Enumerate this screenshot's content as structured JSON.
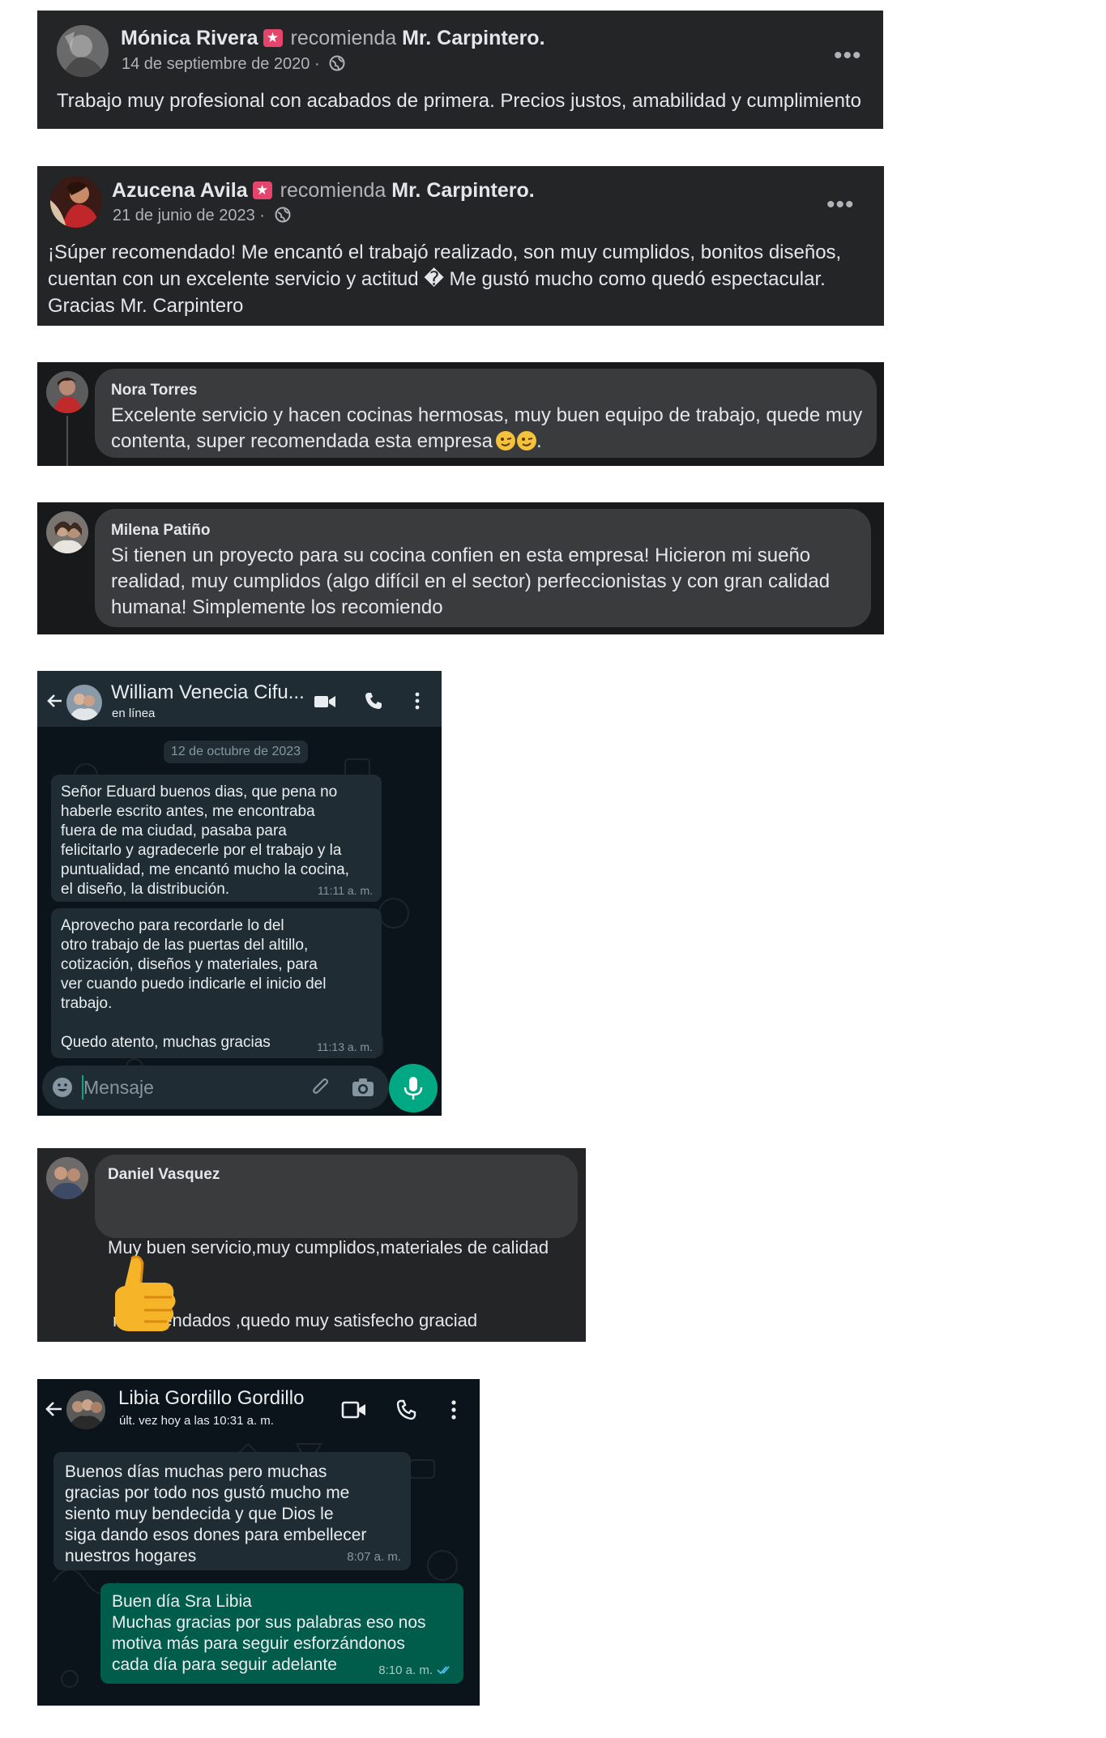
{
  "post1": {
    "author": "Mónica Rivera",
    "verb": "recomienda",
    "page": "Mr. Carpintero.",
    "date": "14 de septiembre de 2020 ·",
    "more": "•••",
    "text": "Trabajo muy profesional con acabados de primera. Precios justos, amabilidad y cumplimiento"
  },
  "post2": {
    "author": "Azucena Avila",
    "verb": "recomienda",
    "page": "Mr. Carpintero.",
    "date": "21 de junio de 2023 ·",
    "more": "•••",
    "text_lines": [
      "¡Súper recomendado! Me encantó el trabajó realizado, son muy cumplidos, bonitos diseños,",
      "cuentan con un excelente servicio y actitud � Me gustó mucho como quedó espectacular.",
      "Gracias Mr. Carpintero"
    ]
  },
  "comment1": {
    "author": "Nora Torres",
    "text_lines": [
      "Excelente servicio y hacen cocinas hermosas, muy buen equipo de trabajo, quede muy",
      "contenta, super recomendada esta empresa"
    ],
    "text_end": "."
  },
  "comment2": {
    "author": "Milena Patiño",
    "text_lines": [
      "Si tienen un proyecto para su cocina confien en esta empresa! Hicieron mi sueño",
      "realidad, muy cumplidos (algo difícil en el sector) perfeccionistas y con gran calidad",
      "humana! Simplemente los recomiendo"
    ]
  },
  "wa1": {
    "contact": "William Venecia Cifu...",
    "status": "en línea",
    "date_chip": "12 de octubre de 2023",
    "msg1_lines": [
      "Señor Eduard buenos dias, que pena no",
      "haberle escrito antes, me encontraba",
      "fuera de ma ciudad, pasaba para",
      "felicitarlo y agradecerle por el trabajo y la",
      "puntualidad, me encantó mucho la cocina,",
      "el diseño, la distribución."
    ],
    "msg1_time": "11:11 a. m.",
    "msg2_lines": [
      "Aprovecho para recordarle lo del",
      "otro trabajo de las puertas del altillo,",
      "cotización, diseños y materiales, para",
      "ver cuando puedo indicarle el inicio del",
      "trabajo."
    ],
    "msg2_last": "Quedo atento, muchas gracias",
    "msg2_time": "11:13 a. m.",
    "input_placeholder": "Mensaje"
  },
  "comment3": {
    "author": "Daniel Vasquez",
    "text_lines": [
      "Muy buen servicio,muy cumplidos,materiales de calidad",
      " recomendados ,quedo muy satisfecho graciad"
    ]
  },
  "wa2": {
    "contact": "Libia Gordillo Gordillo",
    "status": "últ. vez hoy a las 10:31 a. m.",
    "in_lines": [
      "Buenos días muchas pero muchas",
      "gracias por todo nos gustó mucho me",
      "siento muy bendecida y que Dios le",
      "siga dando esos dones para embellecer",
      "nuestros hogares"
    ],
    "in_time": "8:07 a. m.",
    "out_lines": [
      "Buen día Sra Libia",
      "Muchas gracias por sus palabras eso nos",
      "motiva más para seguir esforzándonos",
      "cada día para seguir adelante"
    ],
    "out_time": "8:10 a. m."
  },
  "colors": {
    "fb_card": "#242526",
    "fb_comment_bubble": "#3a3b3c",
    "badge": "#e5456c",
    "wa_bg": "#0b141a",
    "wa_bubble_in": "#1f2c34",
    "wa_bubble_out": "#005c4b",
    "wa_mic": "#00a884"
  },
  "icons": [
    "globe-icon",
    "more-options-icon",
    "recommend-badge-icon",
    "back-arrow-icon",
    "video-call-icon",
    "phone-call-icon",
    "menu-dots-icon",
    "emoji-icon",
    "attach-icon",
    "camera-icon",
    "mic-icon",
    "read-receipt-icon",
    "thumbs-up-icon",
    "wink-emoji-icon"
  ]
}
